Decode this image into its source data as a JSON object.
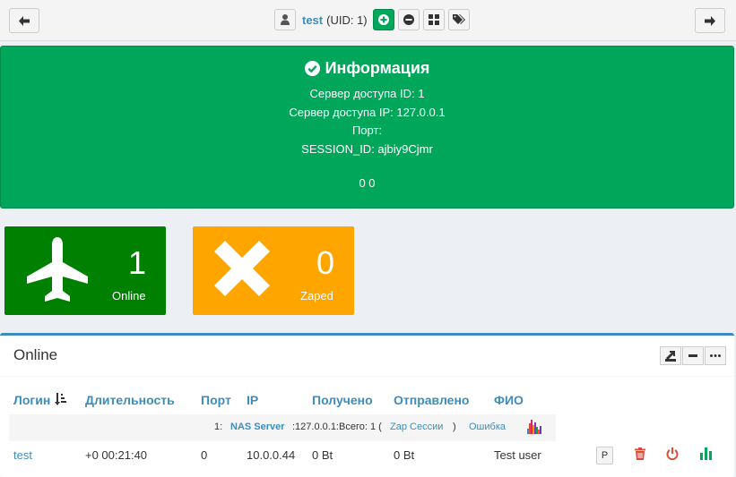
{
  "topbar": {
    "user": "test",
    "uid": "(UID: 1)"
  },
  "info": {
    "title": "Информация",
    "lines": [
      "Сервер доступа ID: 1",
      "Сервер доступа IP: 127.0.0.1",
      "Порт:",
      "SESSION_ID: ajbiy9Cjmr"
    ],
    "counts": "0 0"
  },
  "tiles": {
    "online": {
      "value": "1",
      "label": "Online",
      "color": "#008000"
    },
    "zaped": {
      "value": "0",
      "label": "Zaped",
      "color": "#ffa500"
    }
  },
  "online_box": {
    "title": "Online",
    "columns": [
      "Логин",
      "Длительность",
      "Порт",
      "IP",
      "Получено",
      "Отправлено",
      "ФИО"
    ],
    "group": {
      "index": "1:",
      "nas": "NAS Server",
      "info": ":127.0.0.1:Всего: 1 (",
      "zap": "Zap Сессии",
      "close": ")",
      "error": "Ошибка"
    },
    "rows": [
      {
        "login": "test",
        "duration": "+0 00:21:40",
        "port": "0",
        "ip": "10.0.0.44",
        "received": "0 Bt",
        "sent": "0 Bt",
        "fio": "Test user",
        "p_label": "P"
      }
    ]
  },
  "colors": {
    "primary": "#3c8dbc",
    "success": "#00a65a",
    "danger": "#dd4b39"
  }
}
